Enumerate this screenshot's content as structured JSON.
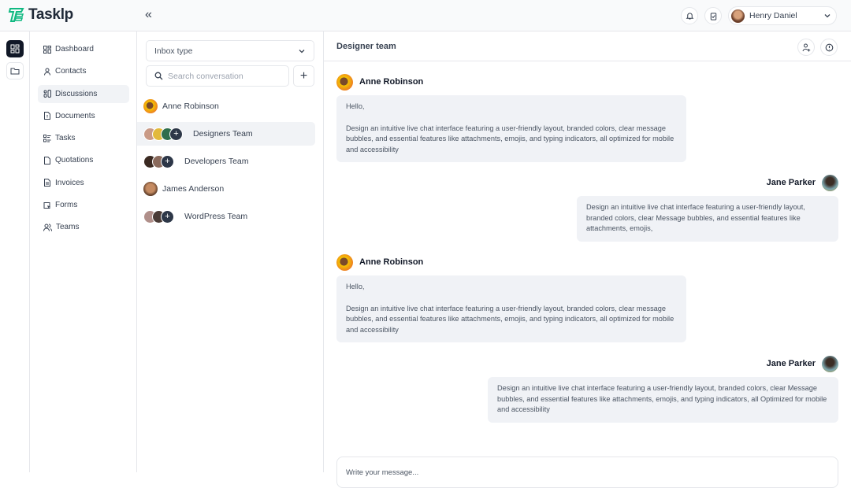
{
  "app": {
    "name": "Tasklp",
    "brand_color": "#10b981"
  },
  "header": {
    "collapse_icon": "double-chevron-left-icon",
    "user": {
      "name": "Henry Daniel"
    },
    "icons": [
      "bell-icon",
      "clipboard-check-icon",
      "chevron-down-icon"
    ]
  },
  "rail": {
    "items": [
      {
        "icon": "grid-icon",
        "active": true
      },
      {
        "icon": "folder-icon",
        "active": false
      }
    ]
  },
  "sidebar": {
    "items": [
      {
        "label": "Dashboard",
        "icon": "dashboard-icon"
      },
      {
        "label": "Contacts",
        "icon": "user-icon"
      },
      {
        "label": "Discussions",
        "icon": "discussions-icon",
        "active": true
      },
      {
        "label": "Documents",
        "icon": "document-icon"
      },
      {
        "label": "Tasks",
        "icon": "tasks-icon"
      },
      {
        "label": "Quotations",
        "icon": "file-icon"
      },
      {
        "label": "Invoices",
        "icon": "invoice-icon"
      },
      {
        "label": "Forms",
        "icon": "forms-icon"
      },
      {
        "label": "Teams",
        "icon": "users-icon"
      }
    ]
  },
  "conversations": {
    "inbox_type": {
      "value": "Inbox type"
    },
    "search": {
      "placeholder": "Search conversation"
    },
    "add_label": "+",
    "items": [
      {
        "name": "Anne Robinson",
        "type": "single"
      },
      {
        "name": "Designers Team",
        "type": "group",
        "active": true
      },
      {
        "name": "Developers Team",
        "type": "group"
      },
      {
        "name": "James Anderson",
        "type": "single"
      },
      {
        "name": "WordPress Team",
        "type": "group"
      }
    ]
  },
  "chat": {
    "title": "Designer team",
    "messages": [
      {
        "sender": "Anne Robinson",
        "side": "left",
        "greeting": "Hello,",
        "body": "Design an intuitive live chat interface featuring a user-friendly layout, branded colors, clear message bubbles, and essential features like attachments, emojis, and typing indicators, all optimized for mobile and accessibility"
      },
      {
        "sender": "Jane Parker",
        "side": "right",
        "body": "Design an intuitive live chat interface featuring a user-friendly layout, branded colors, clear Message bubbles, and essential features like attachments, emojis,"
      },
      {
        "sender": "Anne Robinson",
        "side": "left",
        "greeting": "Hello,",
        "body": "Design an intuitive live chat interface featuring a user-friendly layout, branded colors, clear message bubbles, and essential features like attachments, emojis, and typing indicators, all optimized for mobile and accessibility"
      },
      {
        "sender": "Jane Parker",
        "side": "right",
        "body": "Design an intuitive live chat interface featuring a user-friendly layout, branded colors, clear Message bubbles, and essential features like attachments, emojis, and typing indicators, all Optimized for mobile and accessibility"
      }
    ],
    "composer": {
      "placeholder": "Write your message..."
    }
  }
}
